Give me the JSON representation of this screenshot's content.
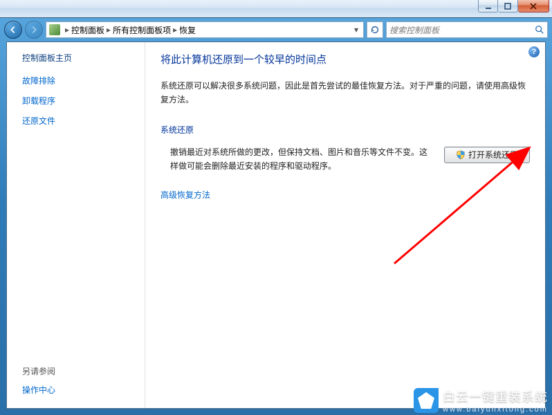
{
  "titlebar": {},
  "nav": {
    "breadcrumbs": [
      "控制面板",
      "所有控制面板项",
      "恢复"
    ],
    "search_placeholder": "搜索控制面板"
  },
  "sidebar": {
    "heading": "控制面板主页",
    "links": [
      "故障排除",
      "卸载程序",
      "还原文件"
    ],
    "see_also_heading": "另请参阅",
    "see_also_links": [
      "操作中心"
    ]
  },
  "content": {
    "title": "将此计算机还原到一个较早的时间点",
    "description": "系统还原可以解决很多系统问题，因此是首先尝试的最佳恢复方法。对于严重的问题，请使用高级恢复方法。",
    "section_heading": "系统还原",
    "restore_text": "撤销最近对系统所做的更改，但保持文档、图片和音乐等文件不变。这样做可能会删除最近安装的程序和驱动程序。",
    "restore_button_label": "打开系统还原",
    "advanced_link": "高级恢复方法"
  },
  "watermark": {
    "title": "白云一键重装系统",
    "sub": "www.baiyunxitong.com"
  }
}
